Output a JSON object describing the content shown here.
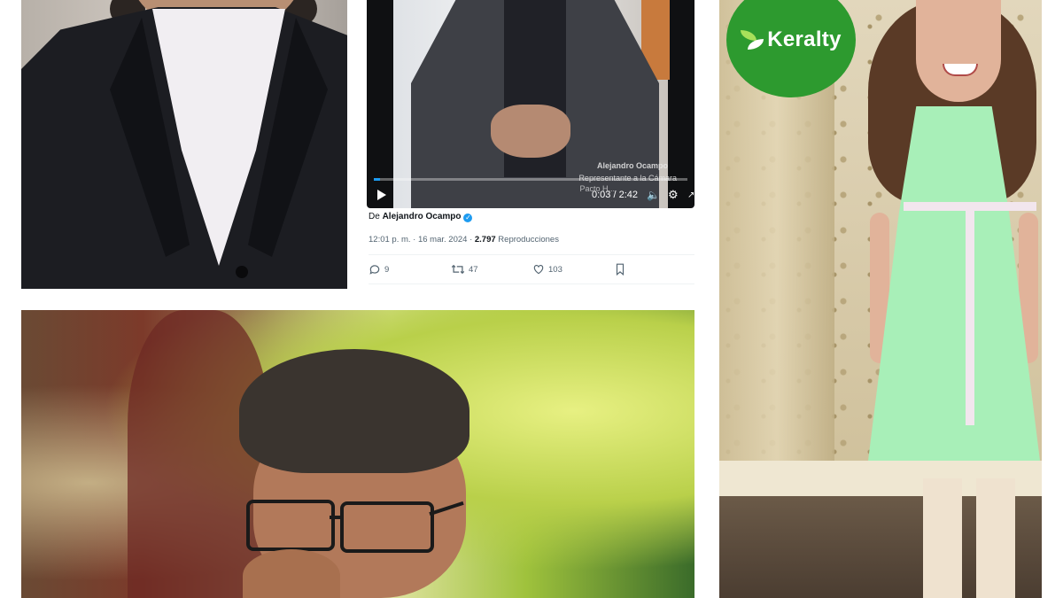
{
  "tweet": {
    "video": {
      "overlay_name": "Alejandro Ocampo",
      "overlay_subtitle": "Representante a la Cámara",
      "overlay_subtitle_2": "Pacto H...",
      "time": "0:03 / 2:42",
      "progress_fraction": 0.02
    },
    "by_prefix": "De",
    "author": "Alejandro Ocampo",
    "timestamp": "12:01 p. m. · 16 mar. 2024 ·",
    "views_count": "2.797",
    "views_label": "Reproducciones",
    "replies": "9",
    "reposts": "47",
    "likes": "103"
  },
  "logo": {
    "brand": "Keralty",
    "color": "#2d9a2f"
  },
  "colors": {
    "twitter_blue": "#1d9bf0",
    "meta_gray": "#536471"
  },
  "icons": {
    "play": "play-icon",
    "volume": "volume-icon",
    "settings": "gear-icon",
    "reply": "reply-icon",
    "repost": "repost-icon",
    "like": "heart-icon",
    "bookmark": "bookmark-icon"
  }
}
